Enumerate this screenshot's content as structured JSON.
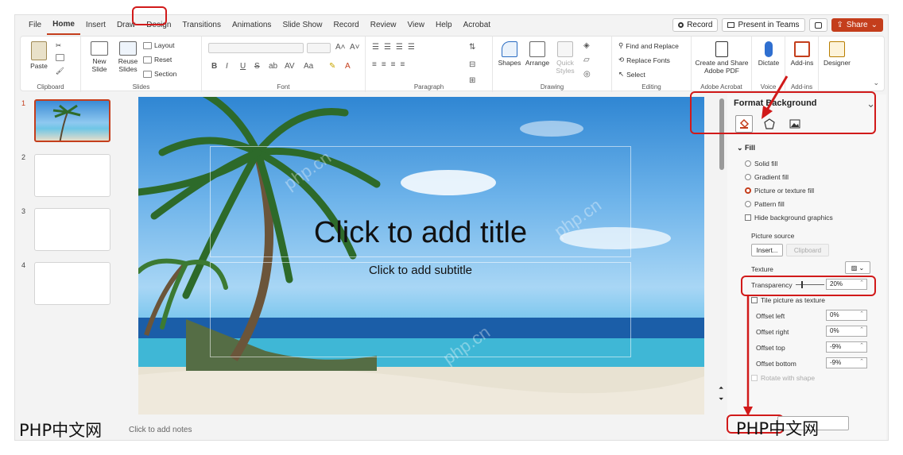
{
  "ribbon_tabs": [
    "File",
    "Home",
    "Insert",
    "Draw",
    "Design",
    "Transitions",
    "Animations",
    "Slide Show",
    "Record",
    "Review",
    "View",
    "Help",
    "Acrobat"
  ],
  "top_buttons": {
    "record": "Record",
    "present": "Present in Teams",
    "share": "Share"
  },
  "clipboard": {
    "paste": "Paste",
    "label": "Clipboard"
  },
  "slides_group": {
    "new_slide": "New Slide",
    "reuse": "Reuse Slides",
    "layout": "Layout",
    "reset": "Reset",
    "section": "Section",
    "label": "Slides"
  },
  "font_group": {
    "label": "Font",
    "bold": "B",
    "italic": "I",
    "underline": "U",
    "strike": "S"
  },
  "paragraph_group": {
    "label": "Paragraph"
  },
  "drawing_group": {
    "shapes": "Shapes",
    "arrange": "Arrange",
    "quick_styles": "Quick Styles",
    "label": "Drawing"
  },
  "editing_group": {
    "find": "Find and Replace",
    "replace": "Replace Fonts",
    "select": "Select",
    "label": "Editing"
  },
  "acrobat_group": {
    "create": "Create and Share Adobe PDF",
    "label": "Adobe Acrobat"
  },
  "voice_group": {
    "dictate": "Dictate",
    "label": "Voice"
  },
  "addins_group": {
    "addins": "Add-ins",
    "label": "Add-ins"
  },
  "designer": "Designer",
  "slides": [
    {
      "num": "1"
    },
    {
      "num": "2"
    },
    {
      "num": "3"
    },
    {
      "num": "4"
    }
  ],
  "canvas": {
    "title": "Click to add title",
    "subtitle": "Click to add subtitle"
  },
  "notes": "Click to add notes",
  "format_pane": {
    "title": "Format Background",
    "fill_section": "Fill",
    "options": [
      "Solid fill",
      "Gradient fill",
      "Picture or texture fill",
      "Pattern fill"
    ],
    "selected_option": "Picture or texture fill",
    "hide_bg": "Hide background graphics",
    "picture_source": "Picture source",
    "insert": "Insert...",
    "clipboard": "Clipboard",
    "texture": "Texture",
    "transparency_label": "Transparency",
    "transparency_value": "20%",
    "transparency_level": 0.2,
    "tile": "Tile picture as texture",
    "offsets": [
      {
        "label": "Offset left",
        "value": "0%"
      },
      {
        "label": "Offset right",
        "value": "0%"
      },
      {
        "label": "Offset top",
        "value": "-9%"
      },
      {
        "label": "Offset bottom",
        "value": "-9%"
      }
    ],
    "rotate": "Rotate with shape"
  },
  "watermark": "PHP中文网",
  "background_watermark": "php.cn",
  "colors": {
    "accent": "#c43e1c",
    "annotation": "#d11a1a"
  }
}
